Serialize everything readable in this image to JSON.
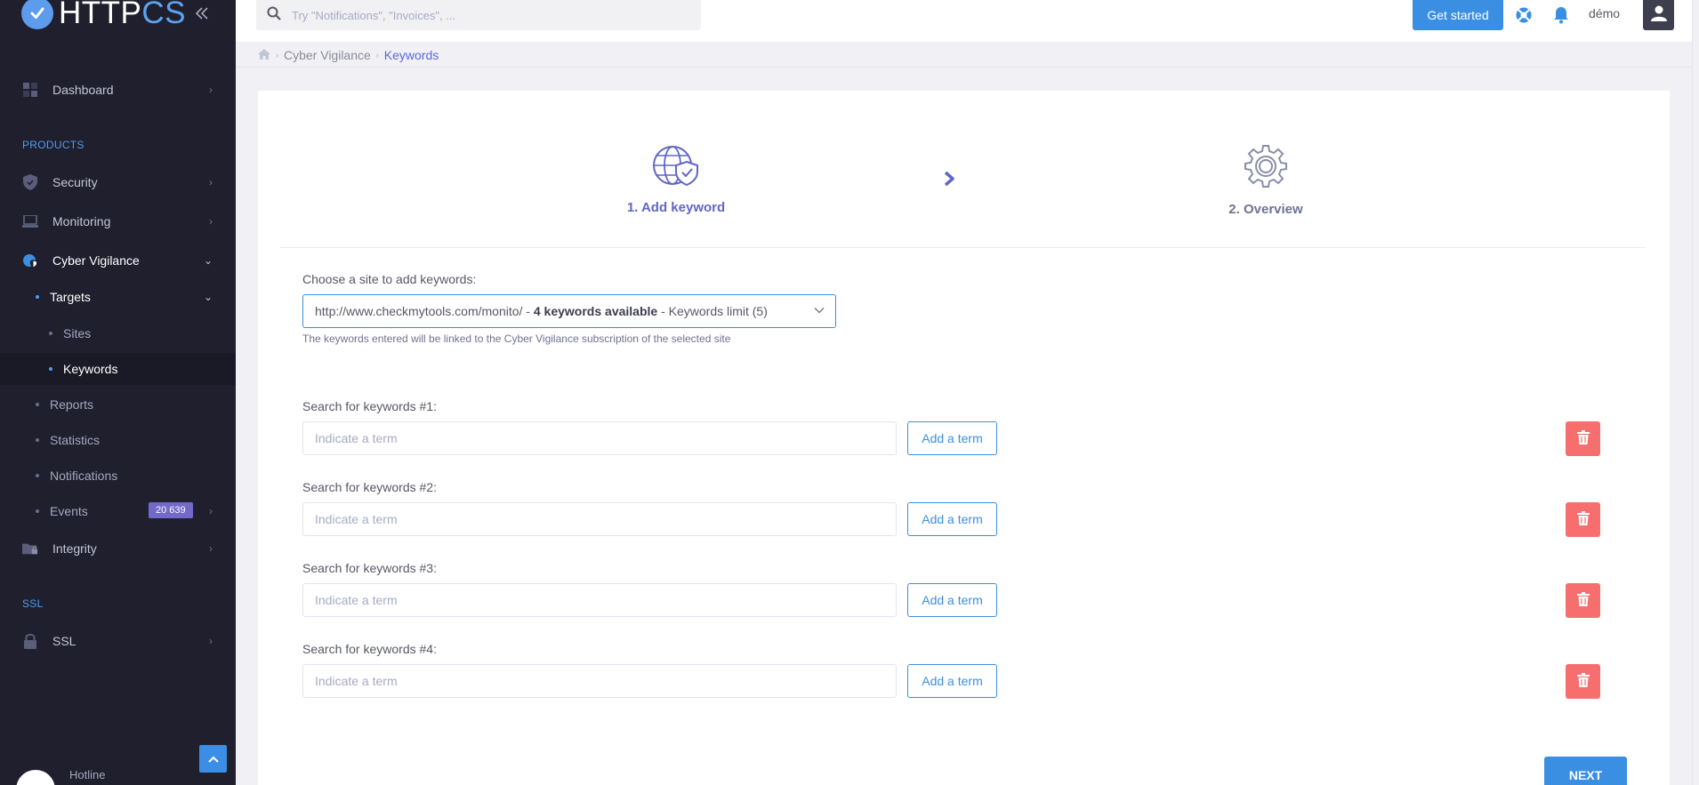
{
  "app": {
    "logo_prefix": "HTTP",
    "logo_suffix": "CS"
  },
  "header": {
    "search_placeholder": "Try \"Notifications\", \"Invoices\", ...",
    "get_started": "Get started",
    "user": "démo"
  },
  "sidebar": {
    "dashboard": "Dashboard",
    "products_title": "PRODUCTS",
    "security": "Security",
    "monitoring": "Monitoring",
    "cyber_vigilance": "Cyber Vigilance",
    "targets": "Targets",
    "sites": "Sites",
    "keywords": "Keywords",
    "reports": "Reports",
    "statistics": "Statistics",
    "notifications": "Notifications",
    "events": "Events",
    "events_count": "20 639",
    "integrity": "Integrity",
    "ssl_title": "SSL",
    "ssl": "SSL",
    "hotline": "Hotline"
  },
  "breadcrumb": {
    "parent": "Cyber Vigilance",
    "current": "Keywords"
  },
  "wizard": {
    "step1": "1. Add keyword",
    "step2": "2. Overview"
  },
  "form": {
    "choose_site_label": "Choose a site to add keywords:",
    "site_url": "http://www.checkmytools.com/monito/",
    "site_available": "4 keywords available",
    "site_limit": "Keywords limit (5)",
    "helper": "The keywords entered will be linked to the Cyber Vigilance subscription of the selected site",
    "keywords": [
      {
        "label": "Search for keywords #1:",
        "placeholder": "Indicate a term",
        "value": ""
      },
      {
        "label": "Search for keywords #2:",
        "placeholder": "Indicate a term",
        "value": ""
      },
      {
        "label": "Search for keywords #3:",
        "placeholder": "Indicate a term",
        "value": ""
      },
      {
        "label": "Search for keywords #4:",
        "placeholder": "Indicate a term",
        "value": ""
      }
    ],
    "add_term": "Add a term",
    "next": "NEXT"
  },
  "colors": {
    "accent": "#3a8fe3",
    "wizard_active": "#6167c4",
    "danger": "#f66e6e",
    "sidebar_bg": "#1f1f2e",
    "badge": "#716aca"
  }
}
